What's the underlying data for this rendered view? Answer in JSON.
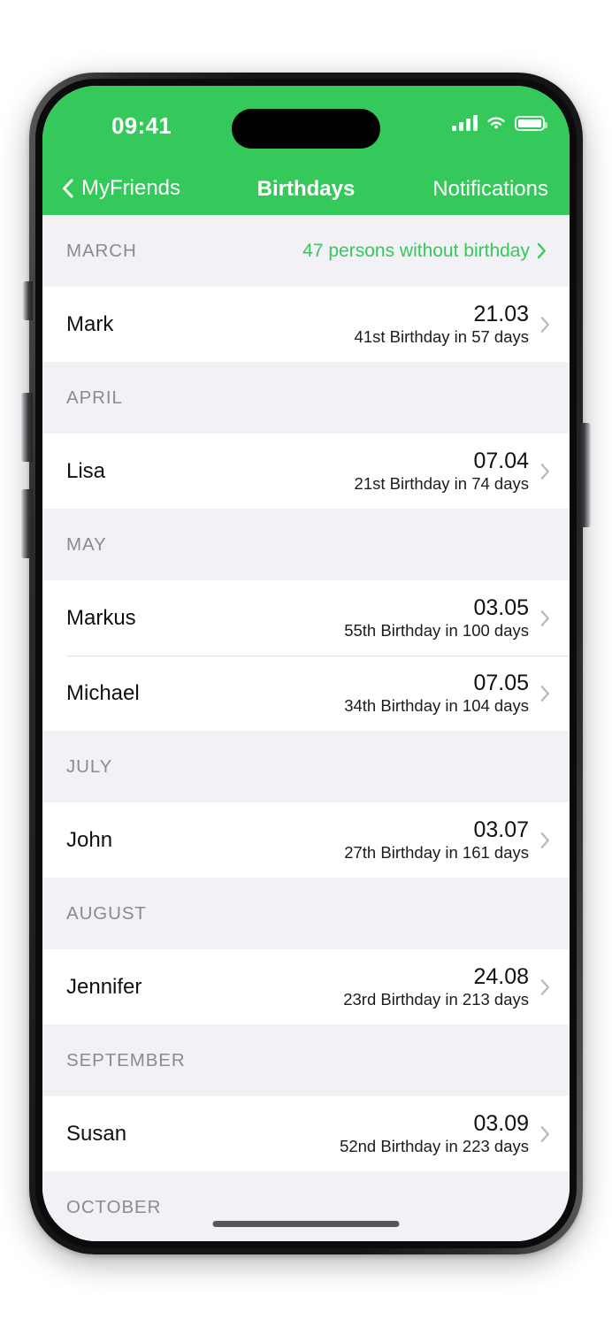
{
  "theme": {
    "accent": "#35c95c",
    "section_bg": "#f1f1f6",
    "row_bg": "#ffffff",
    "section_title_color": "#8a8a90",
    "primary_text": "#111113"
  },
  "status_bar": {
    "time": "09:41",
    "cellular_icon": "signal-bars-icon",
    "wifi_icon": "wifi-icon",
    "battery_icon": "battery-full-icon"
  },
  "nav_bar": {
    "back_icon": "chevron-left-icon",
    "back_label": "MyFriends",
    "title": "Birthdays",
    "right_action_label": "Notifications"
  },
  "no_birthday_link": {
    "label": "47 persons without birthday",
    "count": 47,
    "chevron_icon": "chevron-right-icon"
  },
  "sections": [
    {
      "title": "MARCH",
      "rows": [
        {
          "name": "Mark",
          "date": "21.03",
          "subtitle": "41st Birthday in 57 days",
          "chevron_icon": "chevron-right-icon"
        }
      ]
    },
    {
      "title": "APRIL",
      "rows": [
        {
          "name": "Lisa",
          "date": "07.04",
          "subtitle": "21st Birthday in 74 days",
          "chevron_icon": "chevron-right-icon"
        }
      ]
    },
    {
      "title": "MAY",
      "rows": [
        {
          "name": "Markus",
          "date": "03.05",
          "subtitle": "55th Birthday in 100 days",
          "chevron_icon": "chevron-right-icon"
        },
        {
          "name": "Michael",
          "date": "07.05",
          "subtitle": "34th Birthday in 104 days",
          "chevron_icon": "chevron-right-icon"
        }
      ]
    },
    {
      "title": "JULY",
      "rows": [
        {
          "name": "John",
          "date": "03.07",
          "subtitle": "27th Birthday in 161 days",
          "chevron_icon": "chevron-right-icon"
        }
      ]
    },
    {
      "title": "AUGUST",
      "rows": [
        {
          "name": "Jennifer",
          "date": "24.08",
          "subtitle": "23rd Birthday in 213 days",
          "chevron_icon": "chevron-right-icon"
        }
      ]
    },
    {
      "title": "SEPTEMBER",
      "rows": [
        {
          "name": "Susan",
          "date": "03.09",
          "subtitle": "52nd Birthday in 223 days",
          "chevron_icon": "chevron-right-icon"
        }
      ]
    },
    {
      "title": "OCTOBER",
      "rows": []
    }
  ]
}
